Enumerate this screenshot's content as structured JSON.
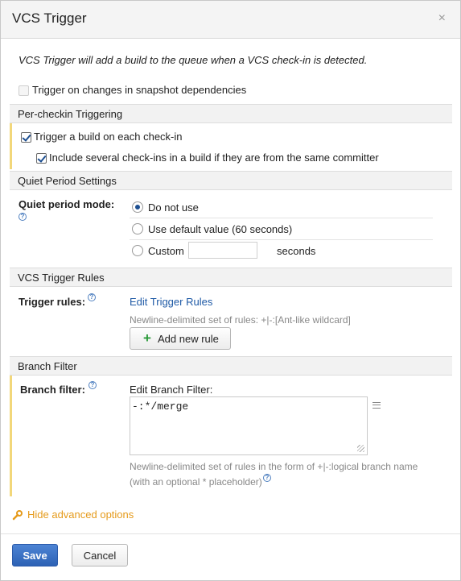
{
  "dialog": {
    "title": "VCS Trigger",
    "close_glyph": "×",
    "intro": "VCS Trigger will add a build to the queue when a VCS check-in is detected."
  },
  "snapshot": {
    "label": "Trigger on changes in snapshot dependencies",
    "checked": false
  },
  "per_checkin": {
    "header": "Per-checkin Triggering",
    "trigger_each_label": "Trigger a build on each check-in",
    "include_several_label": "Include several check-ins in a build if they are from the same committer"
  },
  "quiet_period": {
    "header": "Quiet Period Settings",
    "mode_label": "Quiet period mode:",
    "options": [
      "Do not use",
      "Use default value (60 seconds)",
      "Custom"
    ],
    "selected": "Do not use",
    "custom_value": "",
    "seconds_label": "seconds"
  },
  "trigger_rules": {
    "header": "VCS Trigger Rules",
    "label": "Trigger rules:",
    "edit_link": "Edit Trigger Rules",
    "hint": "Newline-delimited set of rules: +|-:[Ant-like wildcard]",
    "add_button": "Add new rule",
    "add_icon": "+"
  },
  "branch_filter": {
    "header": "Branch Filter",
    "label": "Branch filter:",
    "edit_label": "Edit Branch Filter:",
    "value": "-:*/merge",
    "hint_line1": "Newline-delimited set of rules in the form of +|-:logical branch name",
    "hint_line2": "(with an optional * placeholder)"
  },
  "advanced": {
    "label": "Hide advanced options"
  },
  "footer": {
    "save": "Save",
    "cancel": "Cancel"
  },
  "colors": {
    "accent": "#2d62b5",
    "link": "#1f5aa6",
    "highlight": "#f2d77a",
    "wrench": "#e59a1a"
  }
}
